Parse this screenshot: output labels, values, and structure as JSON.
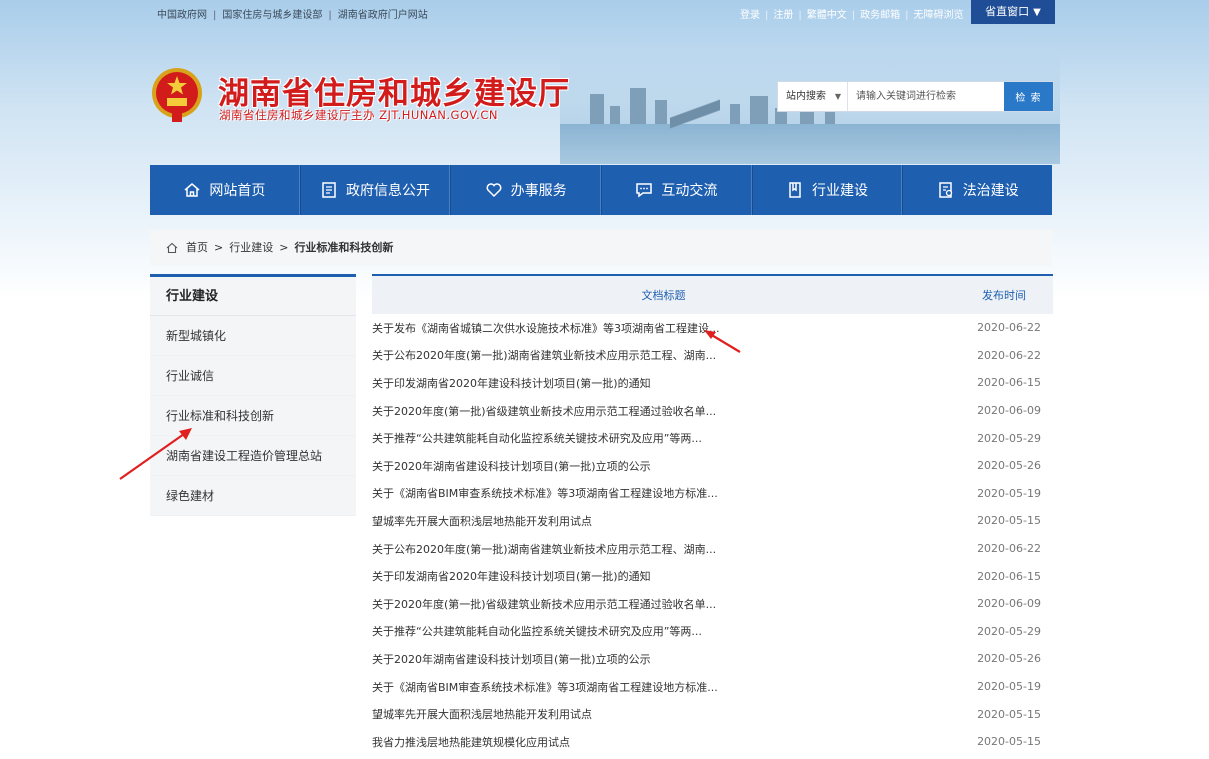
{
  "topbar": {
    "left_links": [
      "中国政府网",
      "国家住房与城乡建设部",
      "湖南省政府门户网站"
    ],
    "right_links": [
      "登录",
      "注册",
      "繁體中文",
      "政务邮箱",
      "无障碍浏览"
    ],
    "province_window": "省直窗口",
    "province_window_icon": "▼"
  },
  "header": {
    "title": "湖南省住房和城乡建设厅",
    "subtitle": "湖南省住房和城乡建设厅主办  ZJT.HUNAN.GOV.CN"
  },
  "search": {
    "scope": "站内搜索",
    "placeholder": "请输入关键词进行检索",
    "button": "检 索"
  },
  "nav": {
    "items": [
      {
        "label": "网站首页",
        "icon": "home-icon"
      },
      {
        "label": "政府信息公开",
        "icon": "document-icon"
      },
      {
        "label": "办事服务",
        "icon": "heart-icon"
      },
      {
        "label": "互动交流",
        "icon": "chat-icon"
      },
      {
        "label": "行业建设",
        "icon": "book-icon"
      },
      {
        "label": "法治建设",
        "icon": "law-icon"
      }
    ]
  },
  "breadcrumb": {
    "items": [
      "首页",
      "行业建设",
      "行业标准和科技创新"
    ],
    "separator": ">"
  },
  "sidebar": {
    "title": "行业建设",
    "items": [
      "新型城镇化",
      "行业诚信",
      "行业标准和科技创新",
      "湖南省建设工程造价管理总站",
      "绿色建材"
    ]
  },
  "doc_list": {
    "headers": {
      "title": "文档标题",
      "date": "发布时间"
    },
    "rows": [
      {
        "title": "关于发布《湖南省城镇二次供水设施技术标准》等3项湖南省工程建设...",
        "date": "2020-06-22"
      },
      {
        "title": "关于公布2020年度(第一批)湖南省建筑业新技术应用示范工程、湖南...",
        "date": "2020-06-22"
      },
      {
        "title": "关于印发湖南省2020年建设科技计划项目(第一批)的通知",
        "date": "2020-06-15"
      },
      {
        "title": "关于2020年度(第一批)省级建筑业新技术应用示范工程通过验收名单...",
        "date": "2020-06-09"
      },
      {
        "title": "关于推荐“公共建筑能耗自动化监控系统关键技术研究及应用”等两...",
        "date": "2020-05-29"
      },
      {
        "title": "关于2020年湖南省建设科技计划项目(第一批)立项的公示",
        "date": "2020-05-26"
      },
      {
        "title": "关于《湖南省BIM审查系统技术标准》等3项湖南省工程建设地方标准...",
        "date": "2020-05-19"
      },
      {
        "title": "望城率先开展大面积浅层地热能开发利用试点",
        "date": "2020-05-15"
      },
      {
        "title": "关于公布2020年度(第一批)湖南省建筑业新技术应用示范工程、湖南...",
        "date": "2020-06-22"
      },
      {
        "title": "关于印发湖南省2020年建设科技计划项目(第一批)的通知",
        "date": "2020-06-15"
      },
      {
        "title": "关于2020年度(第一批)省级建筑业新技术应用示范工程通过验收名单...",
        "date": "2020-06-09"
      },
      {
        "title": "关于推荐“公共建筑能耗自动化监控系统关键技术研究及应用”等两...",
        "date": "2020-05-29"
      },
      {
        "title": "关于2020年湖南省建设科技计划项目(第一批)立项的公示",
        "date": "2020-05-26"
      },
      {
        "title": "关于《湖南省BIM审查系统技术标准》等3项湖南省工程建设地方标准...",
        "date": "2020-05-19"
      },
      {
        "title": "望城率先开展大面积浅层地热能开发利用试点",
        "date": "2020-05-15"
      },
      {
        "title": "我省力推浅层地热能建筑规模化应用试点",
        "date": "2020-05-15"
      }
    ]
  },
  "colors": {
    "brand_blue": "#1f5fb0",
    "title_red": "#d21b1b",
    "annotation_red": "#e02020"
  }
}
